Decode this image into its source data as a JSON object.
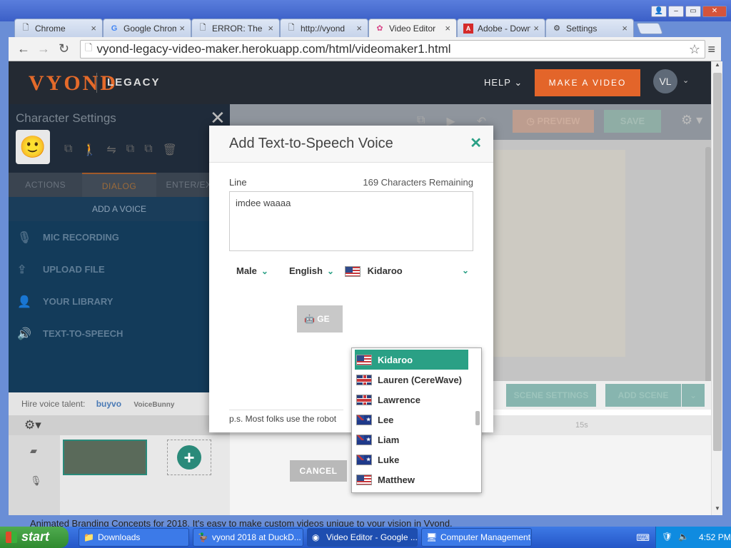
{
  "browser": {
    "tabs": [
      {
        "label": "Chrome",
        "icon": "page-icon"
      },
      {
        "label": "Google Chrom",
        "icon": "google-icon"
      },
      {
        "label": "ERROR: The r",
        "icon": "page-icon"
      },
      {
        "label": "http://vyond",
        "icon": "page-icon"
      },
      {
        "label": "Video Editor",
        "icon": "vyond-icon"
      },
      {
        "label": "Adobe - Down",
        "icon": "adobe-icon"
      },
      {
        "label": "Settings",
        "icon": "gear-icon"
      }
    ],
    "url": "vyond-legacy-video-maker.herokuapp.com/html/videomaker1.html"
  },
  "app": {
    "logo": "VYOND",
    "logo_sub": "LEGACY",
    "help": "HELP",
    "make_video": "MAKE A VIDEO",
    "avatar": "VL"
  },
  "left_panel": {
    "title": "Character Settings",
    "tabs": [
      "ACTIONS",
      "DIALOG",
      "ENTER/EXIT"
    ],
    "add_voice": "ADD A VOICE",
    "options": [
      "MIC RECORDING",
      "UPLOAD FILE",
      "YOUR LIBRARY",
      "TEXT-TO-SPEECH"
    ],
    "hire_label": "Hire voice talent:",
    "hire_brand1": "buyvo",
    "hire_brand2": "VoiceBunny"
  },
  "editor": {
    "preview": "PREVIEW",
    "save": "SAVE",
    "scene_settings": "SCENE SETTINGS",
    "add_scene": "ADD SCENE",
    "timeline_marker": "15s"
  },
  "modal": {
    "title": "Add Text-to-Speech Voice",
    "line_label": "Line",
    "chars_remaining": "169 Characters Remaining",
    "line_value": "imdee waaaa",
    "gender": "Male",
    "language": "English",
    "voice": "Kidaroo",
    "generate_partial": "GE",
    "ps": "p.s. Most folks use the robot",
    "cancel": "CANCEL"
  },
  "dropdown": {
    "items": [
      {
        "label": "Kidaroo",
        "flag": "us"
      },
      {
        "label": "Lauren (CereWave)",
        "flag": "uk"
      },
      {
        "label": "Lawrence",
        "flag": "uk"
      },
      {
        "label": "Lee",
        "flag": "au"
      },
      {
        "label": "Liam",
        "flag": "au"
      },
      {
        "label": "Luke",
        "flag": "au"
      },
      {
        "label": "Matthew",
        "flag": "us"
      }
    ]
  },
  "page_bottom_text": "Animated Branding Concepts for 2018. It's easy to make custom videos unique to your vision in Vyond.",
  "taskbar": {
    "start": "start",
    "tasks": [
      "Downloads",
      "vyond 2018 at DuckD...",
      "Video Editor - Google ...",
      "Computer Management"
    ],
    "clock": "4:52 PM"
  }
}
